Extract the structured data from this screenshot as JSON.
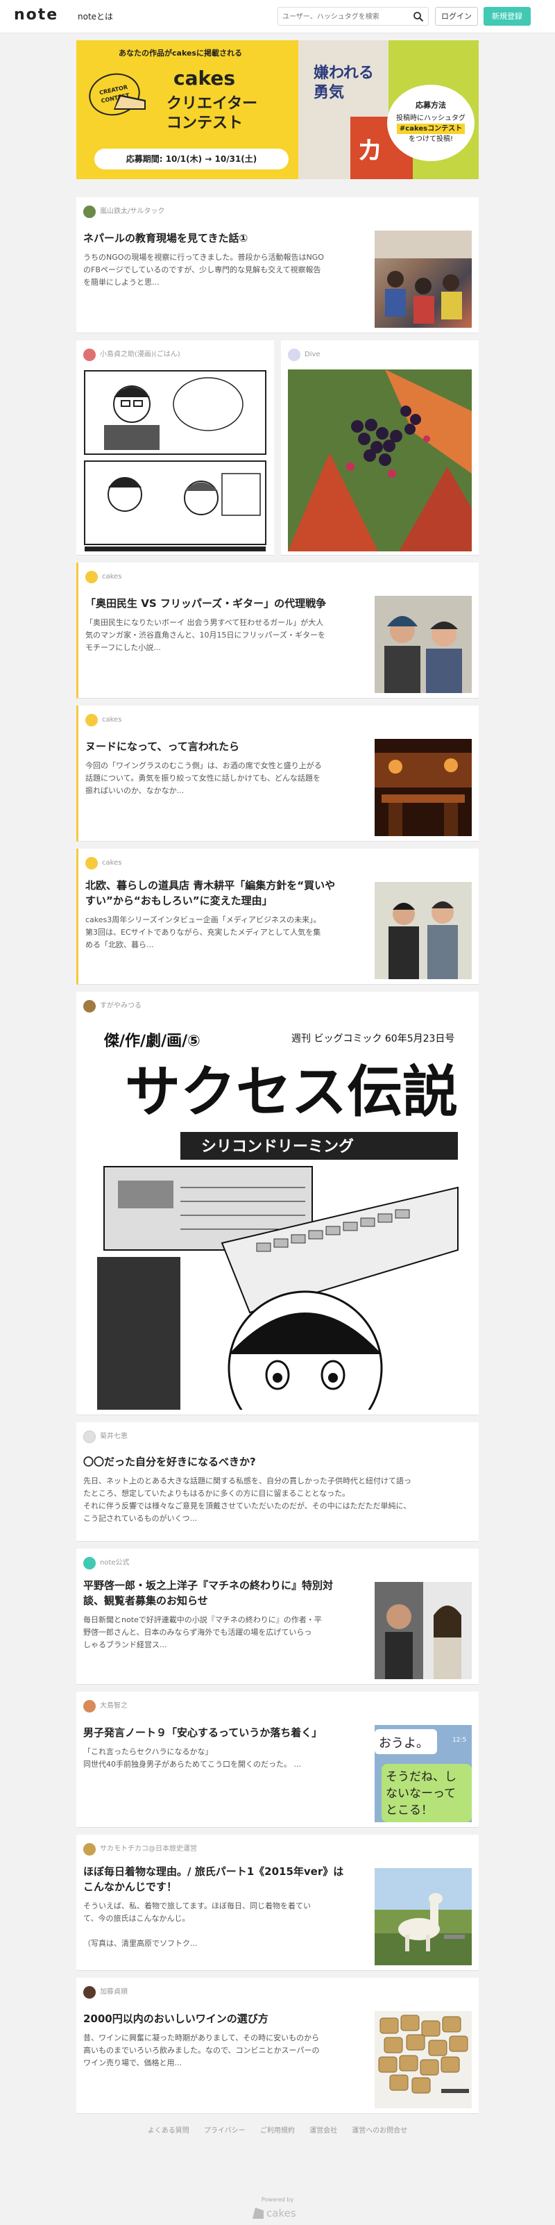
{
  "header": {
    "logo": "note",
    "about": "noteとは",
    "search_placeholder": "ユーザー、ハッシュタグを検索",
    "login": "ログイン",
    "register": "新規登録"
  },
  "banner": {
    "top_text": "あなたの作品がcakesに掲載される",
    "badge": "CREATOR CONTEST",
    "title1": "cakes",
    "title2a": "クリエイター",
    "title2b": "コンテスト",
    "period": "応募期間:  10/1(木) → 10/31(土)",
    "book1_text": "嫌われる勇気",
    "book3_text": "カ",
    "how_heading": "応募方法",
    "how_line1": "投稿時にハッシュタグ",
    "how_tag": "#cakesコンテスト",
    "how_line2": "をつけて投稿!"
  },
  "cards": [
    {
      "author": "嵐山鉄太/サルタック",
      "title": "ネパールの教育現場を見てきた話①",
      "excerpt_lines": [
        "うちのNGOの現場を視察に行ってきました。普段から活動報告はNGO",
        "のFBページでしているのですが、少し専門的な見解も交えて視察報告",
        "を簡単にしようと思..."
      ]
    },
    {
      "author": "小島貞之助(漫画)(ごはん)"
    },
    {
      "author": "Dive"
    },
    {
      "author": "cakes",
      "title": "「奥田民生 VS フリッパーズ・ギター」の代理戦争",
      "excerpt_lines": [
        "「奥田民生になりたいボーイ 出会う男すべて狂わせるガール」が大人",
        "気のマンガ家・渋谷直角さんと、10月15日にフリッパーズ・ギターを",
        "モチーフにした小説..."
      ]
    },
    {
      "author": "cakes",
      "title": "ヌードになって、って言われたら",
      "excerpt_lines": [
        "今回の「ワイングラスのむこう側」は、お酒の席で女性と盛り上がる",
        "話題について。勇気を振り絞って女性に話しかけても、どんな話題を",
        "振ればいいのか、なかなか..."
      ]
    },
    {
      "author": "cakes",
      "title_lines": [
        "北欧、暮らしの道具店 青木耕平「編集方針を“買いや",
        "すい”から“おもしろい”に変えた理由」"
      ],
      "excerpt_lines": [
        "cakes3周年シリーズインタビュー企画「メディアビジネスの未来」。",
        "第3回は、ECサイトでありながら、充実したメディアとして人気を集",
        "める「北欧、暮ら..."
      ]
    },
    {
      "author": "すがやみつる",
      "manga_header": "傑/作/劇/画/⑤",
      "manga_side": "週刊 ビッグコミック 60年5月23日号",
      "manga_title": "サクセス伝説",
      "manga_sub": "シリコンドリーミング"
    },
    {
      "author": "菊井七恵",
      "title": "〇〇だった自分を好きになるべきか?",
      "excerpt_lines": [
        "先日、ネット上のとある大きな話題に関する私感を、自分の貫しかった子供時代と紐付けて語っ",
        "たところ、想定していたよりもはるかに多くの方に目に留まることとなった。",
        "それに伴う反響では様々なご意見を頂戴させていただいたのだが、その中にはただただ単純に、",
        "こう記されているものがいくつ..."
      ]
    },
    {
      "author": "note公式",
      "title_lines": [
        "平野啓一郎・坂之上洋子『マチネの終わりに』特別対",
        "談、観覧者募集のお知らせ"
      ],
      "excerpt_lines": [
        "毎日新聞とnoteで好評連載中の小説『マチネの終わりに』の作者・平",
        "野啓一郎さんと、日本のみならず海外でも活躍の場を広げていらっ",
        "しゃるブランド経営ス..."
      ]
    },
    {
      "author": "大島智之",
      "title": "男子発言ノート９「安心するっていうか落ち着く」",
      "excerpt_lines": [
        "「これ言ったらセクハラになるかな」",
        "同世代40手前独身男子があらためてこう口を開くのだった。 ..."
      ],
      "thumb_text1": "おうよ。",
      "thumb_time": "12:5",
      "thumb_text2": "そうだね、し",
      "thumb_text3": "ないなーって",
      "thumb_text4": "とこる！"
    },
    {
      "author": "サカモトチカコ@日本旅史運営",
      "title_lines": [
        "ほぼ毎日着物な理由。/ 旅氏パート1《2015年ver》は",
        "こんなかんじです！"
      ],
      "excerpt_lines": [
        "そういえば、私、着物で旅してます。ほぼ毎日、同じ着物を着てい",
        "て、今の旅氏はこんなかんじ。",
        "",
        "（写真は、清里高原でソフトク..."
      ]
    },
    {
      "author": "加藤貞順",
      "title": "2000円以内のおいしいワインの選び方",
      "excerpt_lines": [
        "昔、ワインに興奮に凝った時期がありまして、その時に安いものから",
        "高いものまでいろいろ飲みました。なので、コンビニとかスーパーの",
        "ワイン売り場で、価格と用..."
      ]
    }
  ],
  "footer": {
    "links": [
      "よくある質問",
      "プライバシー",
      "ご利用規約",
      "運営会社",
      "運営へのお問合せ"
    ],
    "powered": "Powered by",
    "cakes": "cakes"
  },
  "colors": {
    "accent": "#41c9b4",
    "cakes_yellow": "#f7c93c",
    "banner_yellow": "#f7d32b",
    "background": "#f2f2f2"
  }
}
